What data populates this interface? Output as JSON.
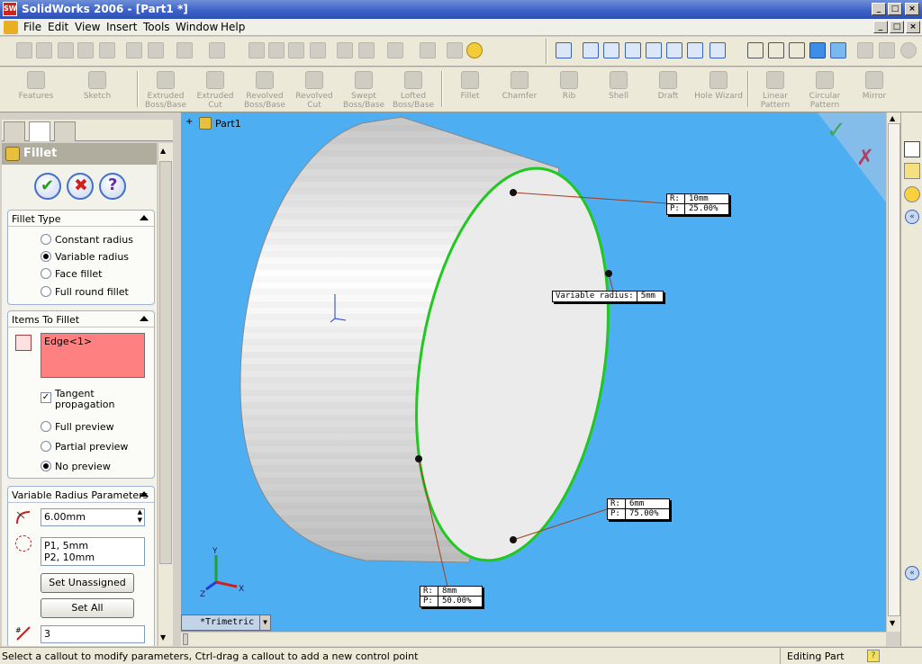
{
  "window": {
    "title": "SolidWorks 2006 - [Part1 *]"
  },
  "menu": [
    "File",
    "Edit",
    "View",
    "Insert",
    "Tools",
    "Window",
    "Help"
  ],
  "feature_toolbar": [
    "Features",
    "Sketch",
    "Extruded Boss/Base",
    "Extruded Cut",
    "Revolved Boss/Base",
    "Revolved Cut",
    "Swept Boss/Base",
    "Lofted Boss/Base",
    "Fillet",
    "Chamfer",
    "Rib",
    "Shell",
    "Draft",
    "Hole Wizard",
    "Linear Pattern",
    "Circular Pattern",
    "Mirror"
  ],
  "property_manager": {
    "title": "Fillet",
    "fillet_type": {
      "header": "Fillet Type",
      "options": [
        "Constant radius",
        "Variable radius",
        "Face fillet",
        "Full round fillet"
      ],
      "selected_index": 1
    },
    "items_to_fillet": {
      "header": "Items To Fillet",
      "selection": "Edge<1>",
      "tangent_propagation": "Tangent propagation",
      "tangent_checked": true,
      "preview_options": [
        "Full preview",
        "Partial preview",
        "No preview"
      ],
      "preview_selected": 2
    },
    "variable_radius": {
      "header": "Variable Radius Parameters",
      "radius_value": "6.00mm",
      "points": [
        "P1, 5mm",
        "P2, 10mm"
      ],
      "set_unassigned": "Set Unassigned",
      "set_all": "Set All",
      "instances": "3"
    }
  },
  "viewport": {
    "tree_label": "Part1",
    "view_name": "*Trimetric",
    "callouts": [
      {
        "r": "10mm",
        "p": "25.00%"
      },
      {
        "label": "Variable radius:",
        "value": "5mm"
      },
      {
        "r": "6mm",
        "p": "75.00%"
      },
      {
        "r": "8mm",
        "p": "50.00%"
      }
    ],
    "axes": {
      "x": "X",
      "y": "Y",
      "z": "Z"
    }
  },
  "status": {
    "message": "Select a callout to modify parameters, Ctrl-drag a callout to add a new control point",
    "mode": "Editing Part"
  },
  "colors": {
    "viewport_bg": "#4eaef2",
    "edge_highlight": "#22c822",
    "selection_box": "#ff8080"
  }
}
